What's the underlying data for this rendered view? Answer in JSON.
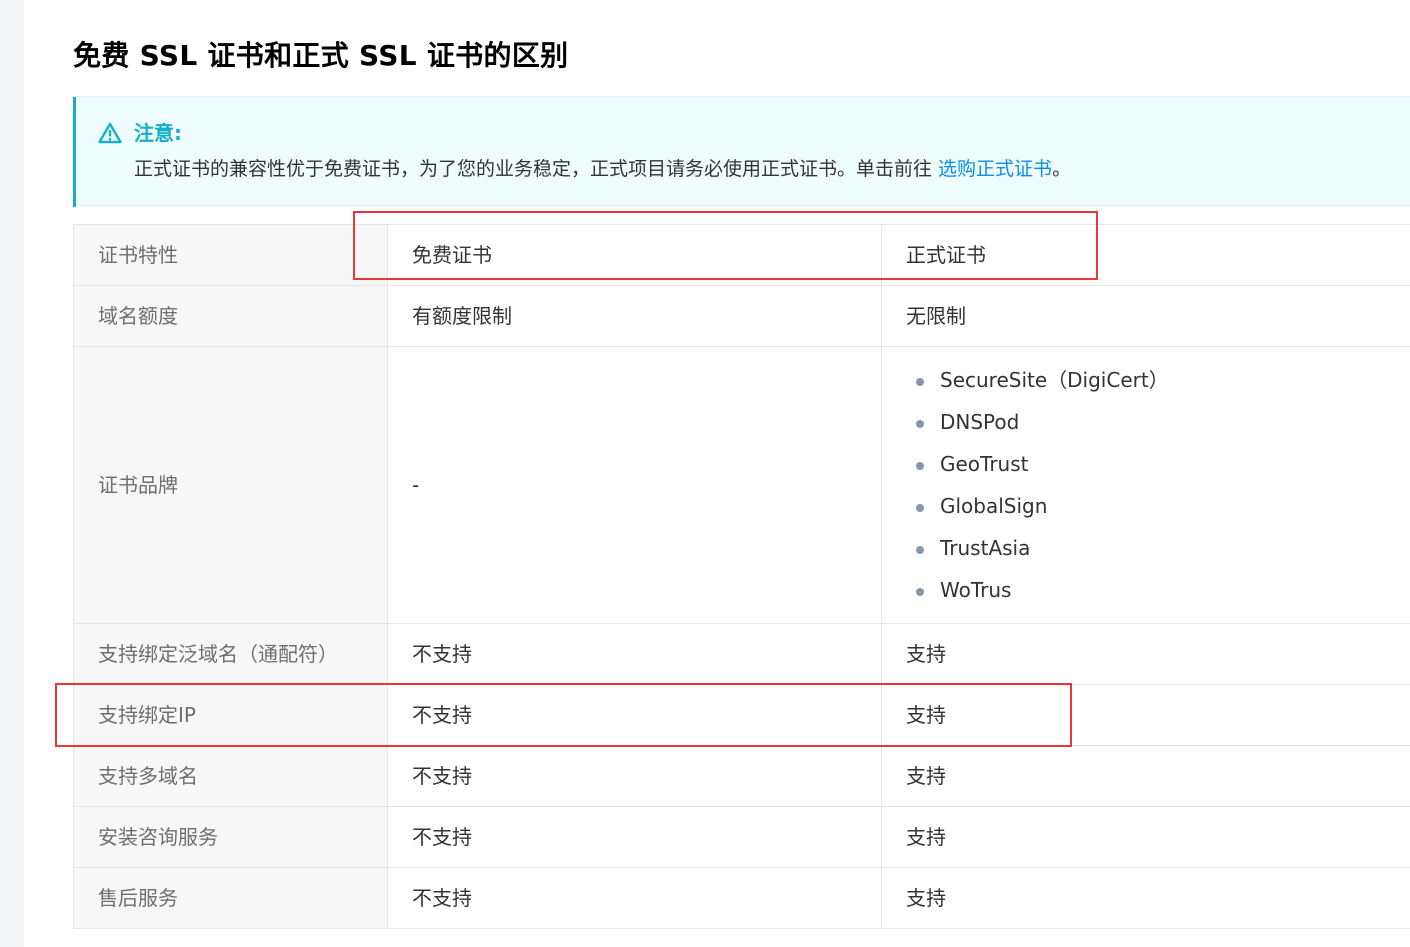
{
  "title": "免费 SSL 证书和正式 SSL 证书的区别",
  "notice": {
    "label": "注意:",
    "text_before": "正式证书的兼容性优于免费证书，为了您的业务稳定，正式项目请务必使用正式证书。单击前往 ",
    "link_text": "选购正式证书",
    "text_after": "。",
    "icon": "warning-triangle-icon",
    "accent_color": "#14b1c7",
    "link_color": "#0a8df2"
  },
  "table": {
    "header": {
      "feature": "证书特性",
      "free": "免费证书",
      "paid": "正式证书"
    },
    "rows": [
      {
        "feature": "域名额度",
        "free": "有额度限制",
        "paid": "无限制"
      },
      {
        "feature": "证书品牌",
        "free": "-",
        "paid_list": [
          "SecureSite（DigiCert）",
          "DNSPod",
          "GeoTrust",
          "GlobalSign",
          "TrustAsia",
          "WoTrus"
        ]
      },
      {
        "feature": "支持绑定泛域名（通配符）",
        "free": "不支持",
        "paid": "支持"
      },
      {
        "feature": "支持绑定IP",
        "free": "不支持",
        "paid": "支持"
      },
      {
        "feature": "支持多域名",
        "free": "不支持",
        "paid": "支持"
      },
      {
        "feature": "安装咨询服务",
        "free": "不支持",
        "paid": "支持"
      },
      {
        "feature": "售后服务",
        "free": "不支持",
        "paid": "支持"
      }
    ]
  },
  "highlight_color": "#e8383c"
}
